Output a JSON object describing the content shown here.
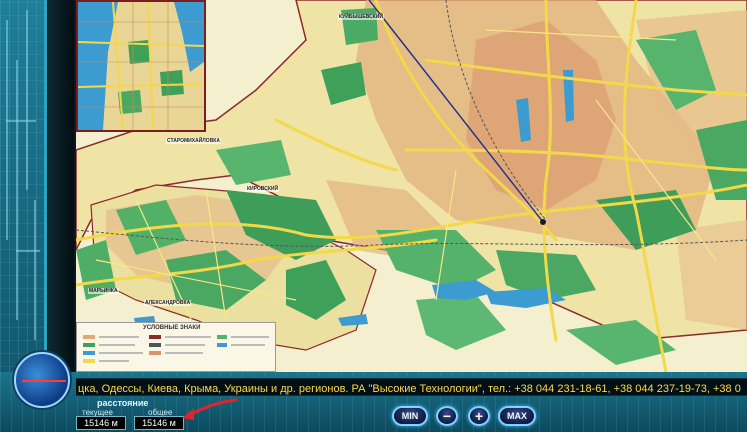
{
  "map": {
    "labels": {
      "kuibyshev": "КУЙБЫШЕВСКИЙ",
      "starominers": "СТАРОМИХАЙЛОВКА",
      "kirov": "КИРОВСКИЙ",
      "maryinka": "МАРЬИНКА",
      "aleksandrovka": "АЛЕКСАНДРОВКА"
    },
    "legend_title": "УСЛОВНЫЕ ЗНАКИ"
  },
  "ticker": {
    "text": "цка, Одессы, Киева, Крыма, Украины и др. регионов. РА \"Высокие Технологии\", тел.: +38 044 231-18-61, +38 044 237-19-73, +38 0"
  },
  "distance": {
    "title": "расстояние",
    "current_label": "текущее",
    "total_label": "общее",
    "current_value": "15146 м",
    "total_value": "15146 м"
  },
  "controls": {
    "min_label": "MIN",
    "zoom_out_label": "−",
    "zoom_in_label": "+",
    "max_label": "MAX"
  },
  "colors": {
    "map_base": "#efe7b6",
    "park": "#3fa05a",
    "urban": "#e3a877",
    "road": "#f3d84a",
    "water": "#3c9bd0",
    "boundary": "#8a2b2b",
    "ticker_text": "#ffd84a"
  }
}
